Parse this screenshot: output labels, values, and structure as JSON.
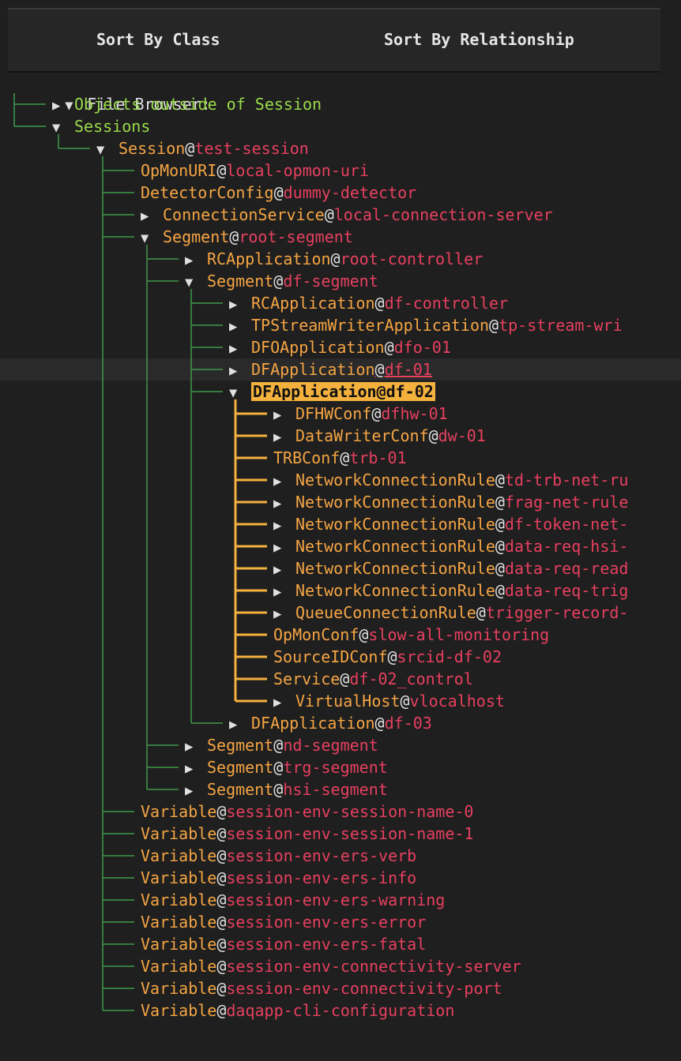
{
  "toolbar": {
    "sort_by_class": "Sort By Class",
    "sort_by_relationship": "Sort By Relationship"
  },
  "tree": {
    "root_label": "File Browser:",
    "rows": [
      {
        "depth": 1,
        "arrow": "▶",
        "cls": "Objects outside of Session",
        "name": "",
        "style": "green"
      },
      {
        "depth": 1,
        "arrow": "▼",
        "cls": "Sessions",
        "name": "",
        "style": "green"
      },
      {
        "depth": 2,
        "arrow": "▼",
        "cls": "Session",
        "name": "test-session"
      },
      {
        "depth": 3,
        "arrow": "",
        "cls": "OpMonURI",
        "name": "local-opmon-uri"
      },
      {
        "depth": 3,
        "arrow": "",
        "cls": "DetectorConfig",
        "name": "dummy-detector"
      },
      {
        "depth": 3,
        "arrow": "▶",
        "cls": "ConnectionService",
        "name": "local-connection-server"
      },
      {
        "depth": 3,
        "arrow": "▼",
        "cls": "Segment",
        "name": "root-segment"
      },
      {
        "depth": 4,
        "arrow": "▶",
        "cls": "RCApplication",
        "name": "root-controller"
      },
      {
        "depth": 4,
        "arrow": "▼",
        "cls": "Segment",
        "name": "df-segment"
      },
      {
        "depth": 5,
        "arrow": "▶",
        "cls": "RCApplication",
        "name": "df-controller"
      },
      {
        "depth": 5,
        "arrow": "▶",
        "cls": "TPStreamWriterApplication",
        "name": "tp-stream-wri"
      },
      {
        "depth": 5,
        "arrow": "▶",
        "cls": "DFOApplication",
        "name": "dfo-01"
      },
      {
        "depth": 5,
        "arrow": "▶",
        "cls": "DFApplication",
        "name": "df-01",
        "hover": true
      },
      {
        "depth": 5,
        "arrow": "▼",
        "cls": "DFApplication",
        "name": "df-02",
        "selected": true
      },
      {
        "depth": 6,
        "arrow": "▶",
        "cls": "DFHWConf",
        "name": "dfhw-01"
      },
      {
        "depth": 6,
        "arrow": "▶",
        "cls": "DataWriterConf",
        "name": "dw-01"
      },
      {
        "depth": 6,
        "arrow": "",
        "cls": "TRBConf",
        "name": "trb-01"
      },
      {
        "depth": 6,
        "arrow": "▶",
        "cls": "NetworkConnectionRule",
        "name": "td-trb-net-ru"
      },
      {
        "depth": 6,
        "arrow": "▶",
        "cls": "NetworkConnectionRule",
        "name": "frag-net-rule"
      },
      {
        "depth": 6,
        "arrow": "▶",
        "cls": "NetworkConnectionRule",
        "name": "df-token-net-"
      },
      {
        "depth": 6,
        "arrow": "▶",
        "cls": "NetworkConnectionRule",
        "name": "data-req-hsi-"
      },
      {
        "depth": 6,
        "arrow": "▶",
        "cls": "NetworkConnectionRule",
        "name": "data-req-read"
      },
      {
        "depth": 6,
        "arrow": "▶",
        "cls": "NetworkConnectionRule",
        "name": "data-req-trig"
      },
      {
        "depth": 6,
        "arrow": "▶",
        "cls": "QueueConnectionRule",
        "name": "trigger-record-"
      },
      {
        "depth": 6,
        "arrow": "",
        "cls": "OpMonConf",
        "name": "slow-all-monitoring"
      },
      {
        "depth": 6,
        "arrow": "",
        "cls": "SourceIDConf",
        "name": "srcid-df-02"
      },
      {
        "depth": 6,
        "arrow": "",
        "cls": "Service",
        "name": "df-02_control"
      },
      {
        "depth": 6,
        "arrow": "▶",
        "cls": "VirtualHost",
        "name": "vlocalhost"
      },
      {
        "depth": 5,
        "arrow": "▶",
        "cls": "DFApplication",
        "name": "df-03"
      },
      {
        "depth": 4,
        "arrow": "▶",
        "cls": "Segment",
        "name": "nd-segment"
      },
      {
        "depth": 4,
        "arrow": "▶",
        "cls": "Segment",
        "name": "trg-segment"
      },
      {
        "depth": 4,
        "arrow": "▶",
        "cls": "Segment",
        "name": "hsi-segment"
      },
      {
        "depth": 3,
        "arrow": "",
        "cls": "Variable",
        "name": "session-env-session-name-0"
      },
      {
        "depth": 3,
        "arrow": "",
        "cls": "Variable",
        "name": "session-env-session-name-1"
      },
      {
        "depth": 3,
        "arrow": "",
        "cls": "Variable",
        "name": "session-env-ers-verb"
      },
      {
        "depth": 3,
        "arrow": "",
        "cls": "Variable",
        "name": "session-env-ers-info"
      },
      {
        "depth": 3,
        "arrow": "",
        "cls": "Variable",
        "name": "session-env-ers-warning"
      },
      {
        "depth": 3,
        "arrow": "",
        "cls": "Variable",
        "name": "session-env-ers-error"
      },
      {
        "depth": 3,
        "arrow": "",
        "cls": "Variable",
        "name": "session-env-ers-fatal"
      },
      {
        "depth": 3,
        "arrow": "",
        "cls": "Variable",
        "name": "session-env-connectivity-server"
      },
      {
        "depth": 3,
        "arrow": "",
        "cls": "Variable",
        "name": "session-env-connectivity-port"
      },
      {
        "depth": 3,
        "arrow": "",
        "cls": "Variable",
        "name": "daqapp-cli-configuration"
      }
    ]
  },
  "colors": {
    "background": "#1f1f1f",
    "class_orange": "#f5a544",
    "name_pink": "#e6405f",
    "green_label": "#9adb4a",
    "guide_green": "#3f9a4a",
    "selection_yellow": "#f4b13d"
  },
  "icons": {
    "collapsed": "triangle-right-icon",
    "expanded": "triangle-down-icon"
  }
}
